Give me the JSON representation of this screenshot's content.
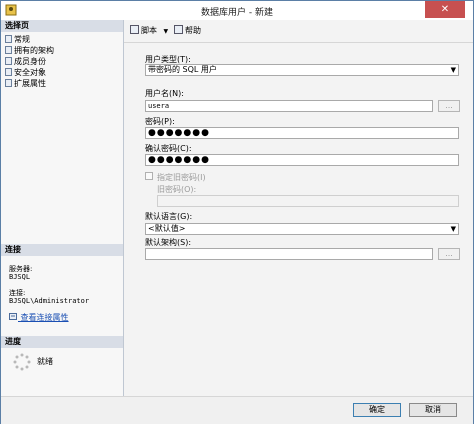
{
  "window": {
    "title": "数据库用户 - 新建",
    "close_glyph": "✕"
  },
  "sidebar": {
    "pages_header": "选择页",
    "pages": [
      "常规",
      "拥有的架构",
      "成员身份",
      "安全对象",
      "扩展属性"
    ],
    "connection_header": "连接",
    "server_label": "服务器:",
    "server_value": "BJSQL",
    "connection_label": "连接:",
    "connection_value": "BJSQL\\Administrator",
    "view_connection_link": "查看连接属性",
    "progress_header": "进度",
    "progress_status": "就绪"
  },
  "toolbar": {
    "script_label": "脚本",
    "help_label": "帮助"
  },
  "form": {
    "user_type_label": "用户类型(T):",
    "user_type_value": "带密码的 SQL 用户",
    "username_label": "用户名(N):",
    "username_value": "usera",
    "password_label": "密码(P):",
    "password_value": "●●●●●●●",
    "confirm_password_label": "确认密码(C):",
    "confirm_password_value": "●●●●●●●",
    "specify_old_password_label": "指定旧密码(I)",
    "old_password_label": "旧密码(O):",
    "default_language_label": "默认语言(G):",
    "default_language_value": "<默认值>",
    "default_schema_label": "默认架构(S):",
    "default_schema_value": "",
    "browse_label": "..."
  },
  "buttons": {
    "ok": "确定",
    "cancel": "取消"
  },
  "colors": {
    "close": "#c75050",
    "link": "#1a4fb3",
    "section_header": "#d8dde6"
  }
}
